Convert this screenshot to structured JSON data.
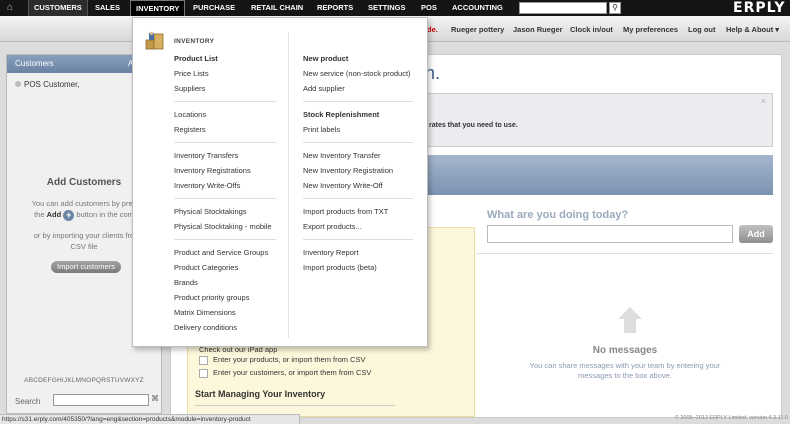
{
  "nav": {
    "home_icon": "⌂",
    "items": [
      "CUSTOMERS",
      "SALES",
      "INVENTORY",
      "PURCHASE",
      "RETAIL CHAIN",
      "REPORTS",
      "SETTINGS",
      "POS",
      "ACCOUNTING"
    ],
    "search_icon": "⚲",
    "logo": "ERPLY"
  },
  "subnav": {
    "partial_left": "de.",
    "links": [
      "Rueger pottery",
      "Jason Rueger",
      "Clock in/out",
      "My preferences",
      "Log out",
      "Help & About ▾"
    ]
  },
  "left_panel": {
    "header": "Customers",
    "header_right": "A",
    "customers": [
      "POS Customer,"
    ],
    "add_title": "Add Customers",
    "add_line1": "You can add customers by pres",
    "add_line2_a": "the",
    "add_line2_link": "Add",
    "add_line2_b": "button in the com",
    "add_line3": "or by importing your clients fro",
    "add_line4": "CSV file",
    "import_button": "Import customers",
    "alphabet": "ABCDEFGHIJKLMNOPQRSTUVWXYZ",
    "search_label": "Search"
  },
  "main": {
    "welcome_partial": "n.",
    "rates_text": "rates that you need to use.",
    "close_icon": "×",
    "what_doing": "What are you doing today?",
    "add_button": "Add",
    "no_messages": "No messages",
    "no_messages_text_1": "You can share messages with your team by entering your",
    "no_messages_text_2": "messages to the box above.",
    "checklist": [
      "Check out our iPad app",
      "Enter your products, or import them from CSV",
      "Enter your customers, or import them from CSV"
    ],
    "manage_title": "Start Managing Your Inventory"
  },
  "inventory_menu": {
    "heading": "INVENTORY",
    "left": [
      [
        "Product List",
        "Price Lists",
        "Suppliers"
      ],
      [
        "Locations",
        "Registers"
      ],
      [
        "Inventory Transfers",
        "Inventory Registrations",
        "Inventory Write-Offs"
      ],
      [
        "Physical Stocktakings",
        "Physical Stocktaking - mobile"
      ],
      [
        "Product and Service Groups",
        "Product Categories",
        "Brands",
        "Product priority groups",
        "Matrix Dimensions",
        "Delivery conditions"
      ]
    ],
    "right": [
      [
        "New product",
        "New service (non-stock product)",
        "Add supplier"
      ],
      [
        "Stock Replenishment",
        "Print labels"
      ],
      [
        "New Inventory Transfer",
        "New Inventory Registration",
        "New Inventory Write-Off"
      ],
      [
        "Import products from TXT",
        "Export products..."
      ],
      [
        "Inventory Report",
        "Import products (beta)"
      ]
    ]
  },
  "status_bar": "https://s31.erply.com/405350/?lang=eng&section=products&module=inventory-product",
  "copyright": "© 2005–2013 ERPLY Limited, version 4.3.11.0"
}
